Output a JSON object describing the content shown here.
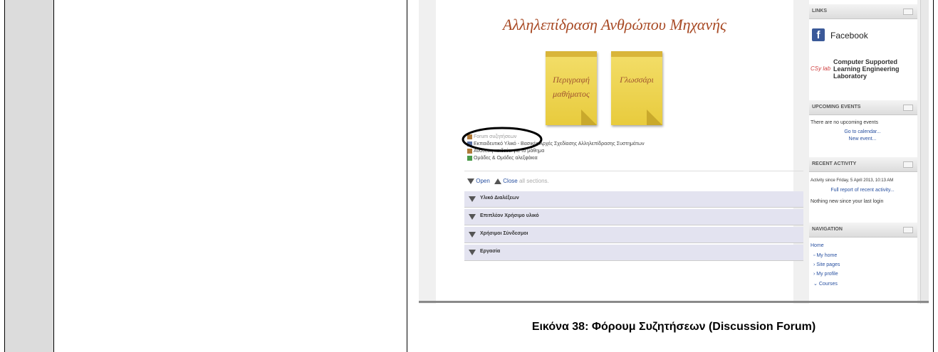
{
  "screenshot": {
    "course_title": "Αλληλεπίδραση Ανθρώπου Μηχανής",
    "notes": [
      {
        "line1": "Περιγραφή",
        "line2": "μαθήματος"
      },
      {
        "line1": "Γλωσσάρι",
        "line2": ""
      }
    ],
    "resources": [
      {
        "label": "Forum συζητήσεων",
        "icon": "forum-icon"
      },
      {
        "label": "Εκπαιδευτικό Υλικό - Βασικές Αρχές Σχεδίασης Αλληλεπίδρασης Συστημάτων",
        "icon": "book-icon"
      },
      {
        "label": "Ανάθεση καιδεύει για το μάθημα",
        "icon": "forum-icon"
      },
      {
        "label": "Ομάδες & Ομάδες αλεξφάκια",
        "icon": "group-icon"
      }
    ],
    "open_label": "Open",
    "close_label": "Close",
    "all_sections_label": "all sections.",
    "sections": [
      "Υλικό Διαλέξεων",
      "Επιπλέον Χρήσιμο υλικό",
      "Χρήσιμοι Σύνδεσμοι",
      "Εργασία"
    ],
    "links_block": {
      "header": "LINKS",
      "facebook": "Facebook",
      "csy_logo_text": "CSy lab",
      "lab_name_line1": "Computer Supported",
      "lab_name_line2": "Learning Engineering",
      "lab_name_line3": "Laboratory"
    },
    "upcoming_block": {
      "header": "UPCOMING EVENTS",
      "text": "There are no upcoming events",
      "goto_calendar": "Go to calendar...",
      "new_event": "New event..."
    },
    "recent_block": {
      "header": "RECENT ACTIVITY",
      "since": "Activity since Friday, 5 April 2013, 10:13 AM",
      "full_report": "Full report of recent activity...",
      "nothing_new": "Nothing new since your last login"
    },
    "nav_block": {
      "header": "NAVIGATION",
      "items": [
        "Home",
        "My home",
        "Site pages",
        "My profile",
        "Courses"
      ]
    }
  },
  "caption": "Εικόνα 38: Φόρουμ Συζητήσεων (Discussion Forum)"
}
